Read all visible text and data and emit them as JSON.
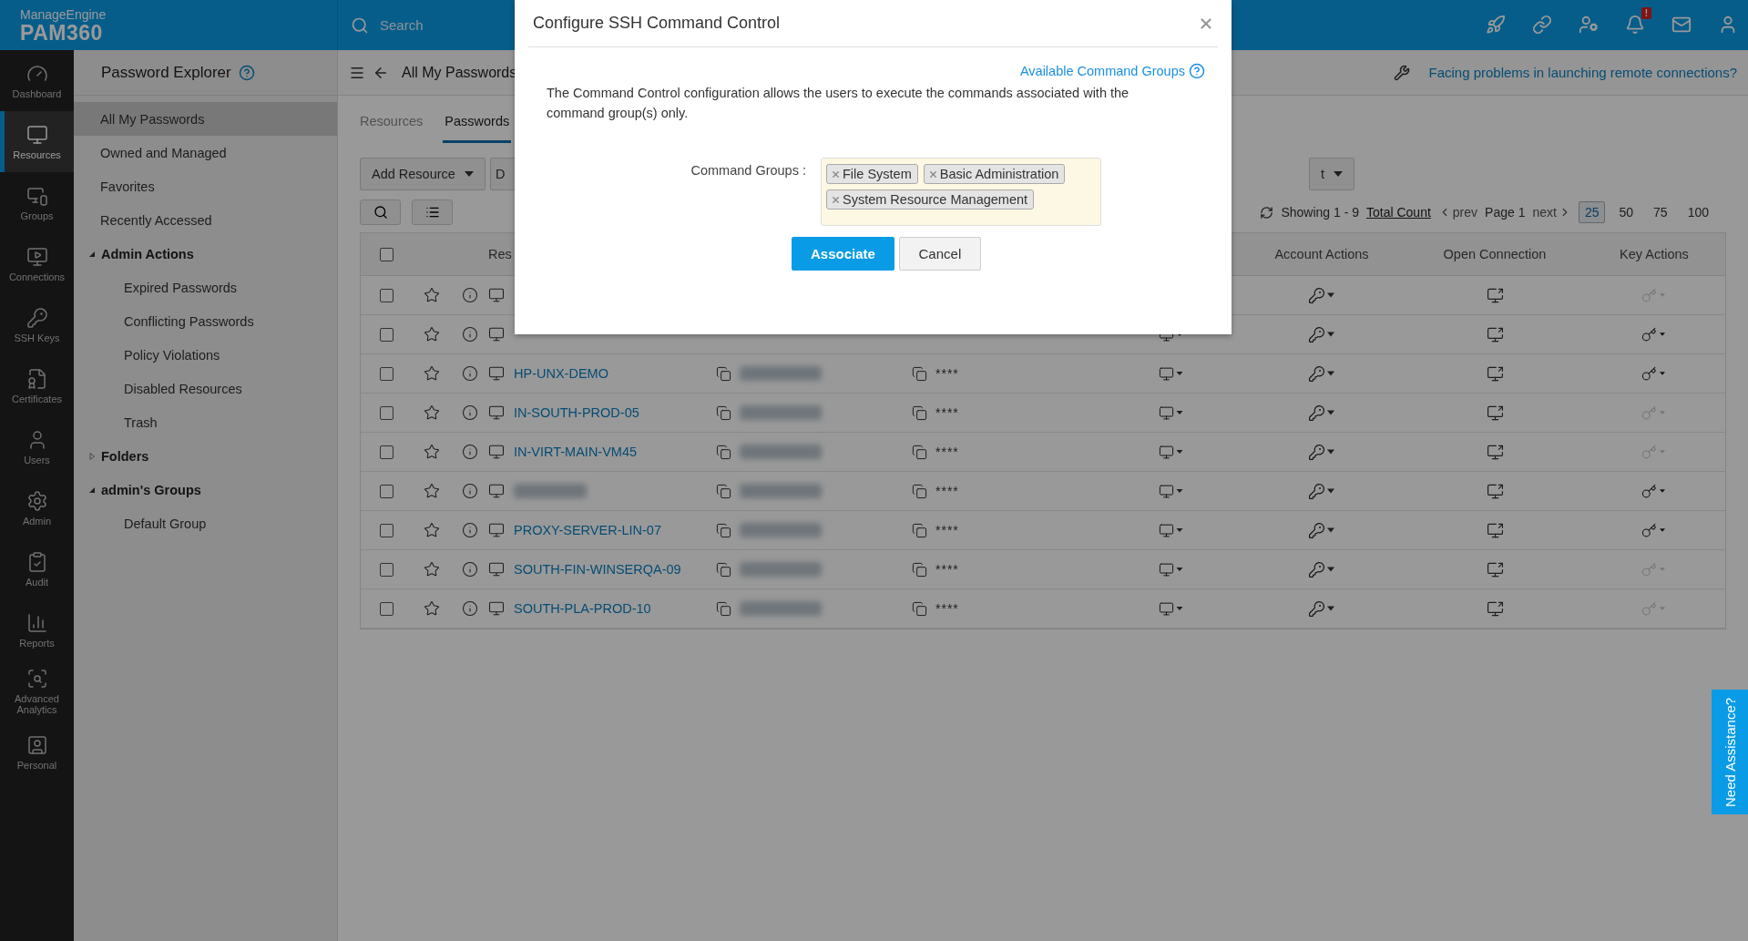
{
  "header": {
    "brand": "ManageEngine",
    "product": "PAM360",
    "search_placeholder": "Search",
    "notification_badge": "!"
  },
  "nav": [
    {
      "label": "Dashboard",
      "selected": false
    },
    {
      "label": "Resources",
      "selected": true
    },
    {
      "label": "Groups",
      "selected": false
    },
    {
      "label": "Connections",
      "selected": false
    },
    {
      "label": "SSH Keys",
      "selected": false
    },
    {
      "label": "Certificates",
      "selected": false
    },
    {
      "label": "Users",
      "selected": false
    },
    {
      "label": "Admin",
      "selected": false
    },
    {
      "label": "Audit",
      "selected": false
    },
    {
      "label": "Reports",
      "selected": false
    },
    {
      "label": "Advanced Analytics",
      "selected": false
    },
    {
      "label": "Personal",
      "selected": false
    }
  ],
  "explorer": {
    "title": "Password Explorer",
    "items": [
      {
        "kind": "link",
        "label": "All My Passwords",
        "selected": true
      },
      {
        "kind": "link",
        "label": "Owned and Managed",
        "selected": false
      },
      {
        "kind": "link",
        "label": "Favorites",
        "selected": false
      },
      {
        "kind": "link",
        "label": "Recently Accessed",
        "selected": false
      },
      {
        "kind": "group",
        "label": "Admin Actions",
        "selected": false,
        "expanded": true,
        "children": [
          {
            "kind": "link",
            "label": "Expired Passwords",
            "selected": false
          },
          {
            "kind": "link",
            "label": "Conflicting Passwords",
            "selected": false
          },
          {
            "kind": "link",
            "label": "Policy Violations",
            "selected": false
          },
          {
            "kind": "link",
            "label": "Disabled Resources",
            "selected": false
          },
          {
            "kind": "link",
            "label": "Trash",
            "selected": false
          }
        ]
      },
      {
        "kind": "group",
        "label": "Folders",
        "selected": false,
        "expanded": false
      },
      {
        "kind": "group",
        "label": "admin's Groups",
        "selected": false,
        "expanded": true,
        "children": [
          {
            "kind": "link",
            "label": "Default Group",
            "selected": false
          }
        ]
      }
    ]
  },
  "main": {
    "title": "All My Passwords",
    "help_link": "Facing problems in launching remote connections?",
    "tabs": [
      {
        "label": "Resources",
        "selected": false
      },
      {
        "label": "Passwords",
        "selected": true
      }
    ],
    "toolbar": [
      {
        "label": "Add Resource",
        "dropdown": true
      },
      {
        "label": "D",
        "dropdown": false
      },
      {
        "label": "t",
        "dropdown": true
      }
    ],
    "pagination": {
      "showing": "Showing 1 - 9",
      "total_link": "Total Count",
      "prev": "prev",
      "page": "Page 1",
      "next": "next",
      "page_sizes": [
        {
          "label": "25",
          "selected": true
        },
        {
          "label": "50",
          "selected": false
        },
        {
          "label": "75",
          "selected": false
        },
        {
          "label": "100",
          "selected": false
        }
      ]
    },
    "table": {
      "select_all_checked": false,
      "partial_column": "Res",
      "columns": [
        "Account Actions",
        "Open Connection",
        "Key Actions"
      ],
      "rows": [
        {
          "checked": false,
          "key_actions_enabled": false
        },
        {
          "checked": false,
          "key_actions_enabled": true
        },
        {
          "checked": false,
          "name": "HP-UNX-DEMO",
          "password": "****",
          "key_actions_enabled": true
        },
        {
          "checked": false,
          "name": "IN-SOUTH-PROD-05",
          "password": "****",
          "key_actions_enabled": false
        },
        {
          "checked": false,
          "name": "IN-VIRT-MAIN-VM45",
          "password": "****",
          "key_actions_enabled": false
        },
        {
          "checked": false,
          "name_blurred": true,
          "password": "****",
          "key_actions_enabled": true
        },
        {
          "checked": false,
          "name": "PROXY-SERVER-LIN-07",
          "password": "****",
          "key_actions_enabled": true
        },
        {
          "checked": false,
          "name": "SOUTH-FIN-WINSERQA-09",
          "password": "****",
          "key_actions_enabled": false
        },
        {
          "checked": false,
          "name": "SOUTH-PLA-PROD-10",
          "password": "****",
          "key_actions_enabled": false
        }
      ]
    }
  },
  "modal": {
    "title": "Configure SSH Command Control",
    "link": "Available Command Groups",
    "description": "The Command Control configuration allows the users to execute the commands associated with the command group(s) only.",
    "field_label": "Command Groups :",
    "tags": [
      "File System",
      "Basic Administration",
      "System Resource Management"
    ],
    "buttons": [
      {
        "label": "Associate",
        "kind": "primary"
      },
      {
        "label": "Cancel",
        "kind": "secondary"
      }
    ]
  },
  "need_assistance": "Need Assistance?"
}
